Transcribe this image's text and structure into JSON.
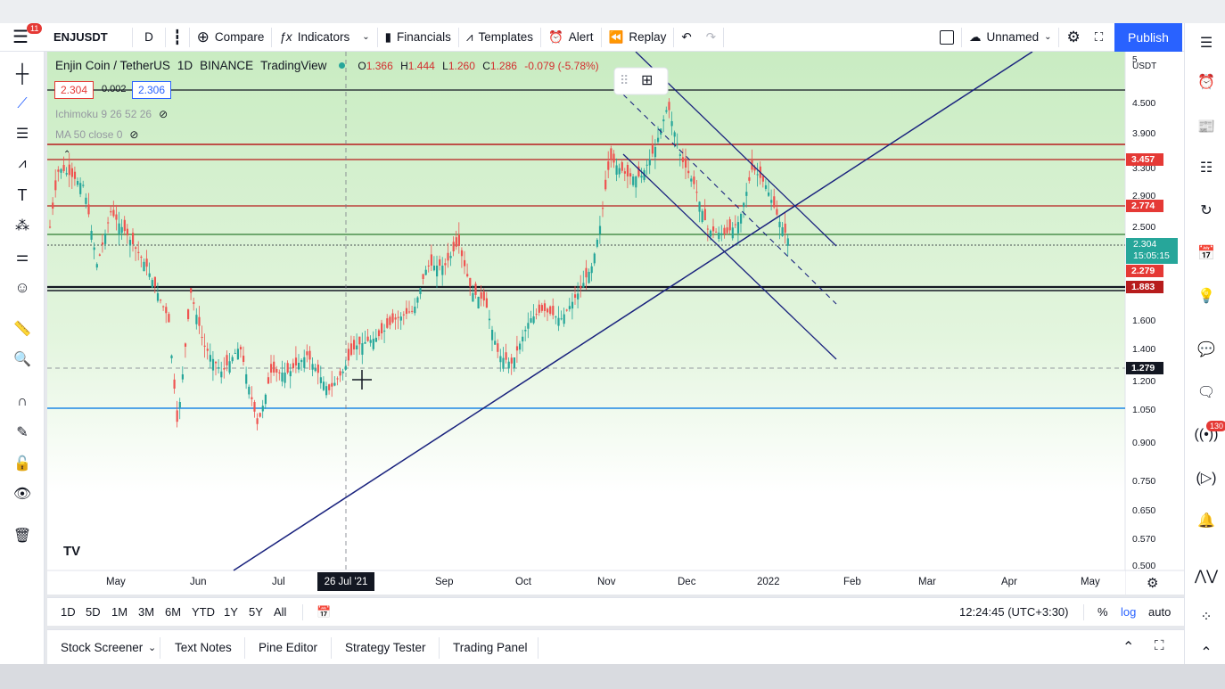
{
  "toolbar": {
    "menu_badge": "11",
    "symbol": "ENJUSDT",
    "interval": "D",
    "compare": "Compare",
    "indicators": "Indicators",
    "financials": "Financials",
    "templates": "Templates",
    "alert": "Alert",
    "replay": "Replay",
    "layout_name": "Unnamed",
    "publish": "Publish"
  },
  "legend": {
    "title": "Enjin Coin / TetherUS",
    "interval": "1D",
    "exchange": "BINANCE",
    "source": "TradingView",
    "open_label": "O",
    "open": "1.366",
    "high_label": "H",
    "high": "1.444",
    "low_label": "L",
    "low": "1.260",
    "close_label": "C",
    "close": "1.286",
    "change": "-0.079 (-5.78%)",
    "bid": "2.304",
    "spread": "0.002",
    "ask": "2.306"
  },
  "indicators": {
    "ichimoku": "Ichimoku 9 26 52 26",
    "ma": "MA 50 close 0"
  },
  "price_axis": {
    "currency": "USDT",
    "top_tick": "5",
    "ticks": [
      "4.500",
      "3.900",
      "3.300",
      "2.900",
      "2.500",
      "1.600",
      "1.400",
      "1.200",
      "1.050",
      "0.900",
      "0.750",
      "0.650",
      "0.570",
      "0.500"
    ],
    "tags": {
      "level_1": "3.457",
      "level_2": "2.774",
      "last_price": "2.304",
      "countdown": "15:05:15",
      "level_3": "2.279",
      "level_4": "1.883",
      "crosshair": "1.279"
    },
    "colors": {
      "red": "#e53935",
      "teal": "#26a69a",
      "black": "#131722"
    }
  },
  "time_axis": {
    "labels": [
      "May",
      "Jun",
      "Jul",
      "Sep",
      "Oct",
      "Nov",
      "Dec",
      "2022",
      "Feb",
      "Mar",
      "Apr",
      "May"
    ],
    "crosshair_date": "26 Jul '21"
  },
  "range_bar": {
    "ranges": [
      "1D",
      "5D",
      "1M",
      "3M",
      "6M",
      "YTD",
      "1Y",
      "5Y",
      "All"
    ],
    "clock": "12:24:45 (UTC+3:30)",
    "percent": "%",
    "log": "log",
    "auto": "auto"
  },
  "bottom_panel": {
    "tabs": [
      "Stock Screener",
      "Text Notes",
      "Pine Editor",
      "Strategy Tester",
      "Trading Panel"
    ]
  },
  "right_sidebar": {
    "notifications_badge": "130"
  }
}
